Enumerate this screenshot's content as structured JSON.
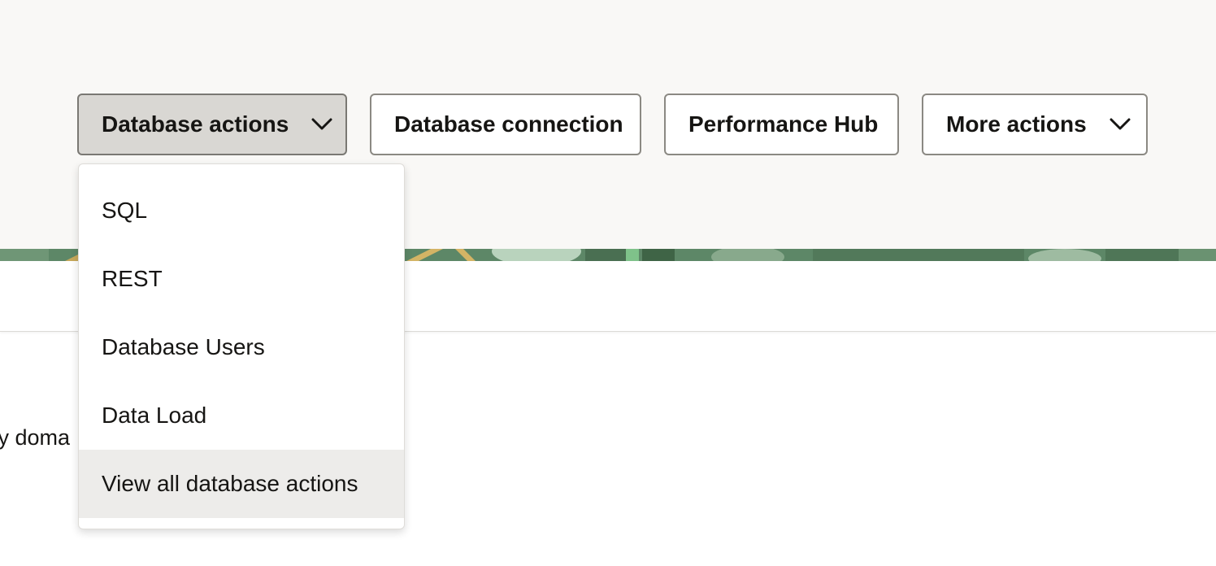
{
  "toolbar": {
    "buttons": [
      {
        "label": "Database actions",
        "has_dropdown": true,
        "state": "expanded"
      },
      {
        "label": "Database connection",
        "has_dropdown": false
      },
      {
        "label": "Performance Hub",
        "has_dropdown": false
      },
      {
        "label": "More actions",
        "has_dropdown": true
      }
    ]
  },
  "dropdown": {
    "items": [
      {
        "label": "SQL"
      },
      {
        "label": "REST"
      },
      {
        "label": "Database Users"
      },
      {
        "label": "Data Load"
      },
      {
        "label": "View all database actions",
        "highlighted": true
      }
    ]
  },
  "body": {
    "partial_text": "ty doma"
  },
  "icons": {
    "dropdown_chevron": "chevron-down-icon"
  },
  "colors": {
    "header_background": "#f9f8f6",
    "active_button_background": "#d9d7d3",
    "button_border": "#8b8983",
    "menu_highlight": "#edecea",
    "banner_green": "#5d8767"
  }
}
